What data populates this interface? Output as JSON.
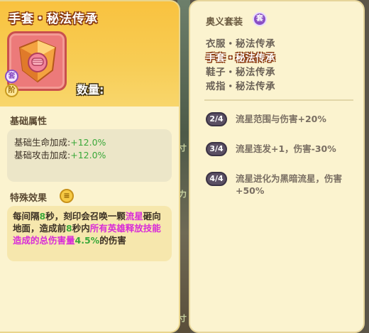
{
  "item": {
    "title": "手套・秘法传承",
    "quantity_label": "数量:",
    "badge_set": "套",
    "badge_level": "阶"
  },
  "base_attributes": {
    "heading": "基础属性",
    "stats": [
      {
        "label": "基础生命加成:",
        "value": "+12.0%"
      },
      {
        "label": "基础攻击加成:",
        "value": "+12.0%"
      }
    ]
  },
  "special_effect": {
    "heading": "特殊效果",
    "icon": "scroll-icon",
    "segments": [
      {
        "text": "每间隔",
        "style": "normal"
      },
      {
        "text": "8",
        "style": "green"
      },
      {
        "text": "秒，刻印会召唤一颗",
        "style": "normal"
      },
      {
        "text": "流星",
        "style": "magenta"
      },
      {
        "text": "砸向地面，造成前",
        "style": "normal"
      },
      {
        "text": "8",
        "style": "green"
      },
      {
        "text": "秒内",
        "style": "normal"
      },
      {
        "text": "所有英雄释放技能造成的总伤害量",
        "style": "magenta"
      },
      {
        "text": "4.5%",
        "style": "green"
      },
      {
        "text": "的伤害",
        "style": "normal"
      }
    ]
  },
  "set_panel": {
    "heading": "奥义套装",
    "set_icon": "套",
    "items": [
      {
        "label": "衣服・秘法传承",
        "active": false
      },
      {
        "label": "手套・秘法传承",
        "active": true
      },
      {
        "label": "鞋子・秘法传承",
        "active": false
      },
      {
        "label": "戒指・秘法传承",
        "active": false
      }
    ],
    "bonuses": [
      {
        "badge": "2/4",
        "text": "流星范围与伤害+20%"
      },
      {
        "badge": "3/4",
        "text": "流星连发+1，伤害-30%"
      },
      {
        "badge": "4/4",
        "text": "流星进化为黑暗流星，伤害+50%"
      }
    ]
  },
  "backdrop_glyphs": [
    "寸",
    "力",
    "寸"
  ],
  "colors": {
    "panel_bg": "#fbf3cf",
    "header_gold": "#f9c23f",
    "highlight_green": "#3aa83a",
    "highlight_magenta": "#d82cd8",
    "bonus_badge": "#5a4f63"
  }
}
